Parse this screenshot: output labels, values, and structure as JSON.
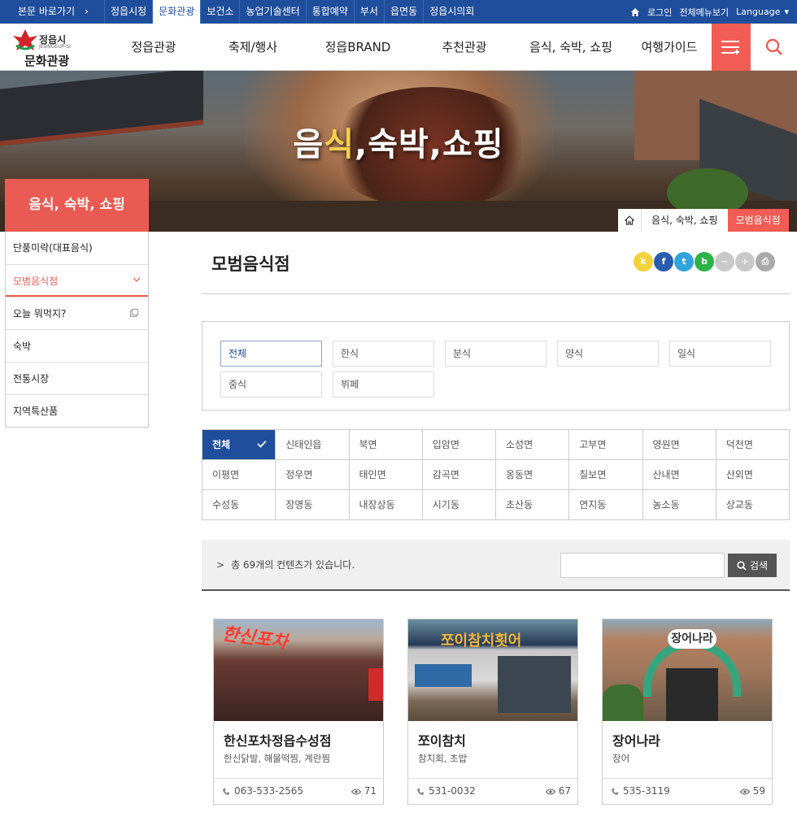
{
  "topbar": {
    "skip_label": "본문 바로가기",
    "skip_arrow": "›",
    "menu": [
      "정읍시청",
      "문화관광",
      "보건소",
      "농업기술센터",
      "통합예약",
      "부서",
      "읍면동",
      "정읍시의회"
    ],
    "active_index": 1,
    "login": "로그인",
    "sitemap": "전체메뉴보기",
    "language": "Language",
    "language_caret": "▾"
  },
  "nav": {
    "logo_city": "정읍시",
    "logo_en": "JEONGEUP-SI",
    "logo_title": "문화관광",
    "items": [
      "정읍관광",
      "축제/행사",
      "정읍BRAND",
      "추천관광",
      "음식, 숙박, 쇼핑",
      "여행가이드"
    ],
    "menu_icon": "hamburger-menu-icon",
    "search_icon": "search-icon"
  },
  "banner": {
    "headline_part1": "음",
    "headline_part2": "식",
    "headline_part3": ",숙박,쇼핑",
    "category": "음식, 숙박, 쇼핑",
    "breadcrumb": [
      "음식, 숙박, 쇼핑",
      "모범음식점"
    ]
  },
  "lnb": {
    "items": [
      "단풍미락(대표음식)",
      "모범음식점",
      "오늘 뭐먹지?",
      "숙박",
      "전통시장",
      "지역특산품"
    ],
    "active_index": 1
  },
  "content": {
    "title": "모범음식점",
    "share": [
      {
        "label": "k",
        "color": "#f3d33a",
        "name": "kakaostory-icon"
      },
      {
        "label": "f",
        "color": "#2a5db0",
        "name": "facebook-icon"
      },
      {
        "label": "t",
        "color": "#33a3dc",
        "name": "twitter-icon"
      },
      {
        "label": "b",
        "color": "#2db34a",
        "name": "blog-icon"
      },
      {
        "label": "−",
        "color": "#c9c9c9",
        "name": "zoom-out-icon"
      },
      {
        "label": "+",
        "color": "#c9c9c9",
        "name": "zoom-in-icon"
      },
      {
        "label": "⎙",
        "color": "#aaaaaa",
        "name": "print-icon"
      }
    ],
    "types": [
      "전체",
      "한식",
      "분식",
      "양식",
      "일식",
      "중식",
      "뷔페"
    ],
    "types_active": 0,
    "regions": [
      [
        "전체",
        "신태인읍",
        "북면",
        "입암면",
        "소성면",
        "고부면",
        "영원면",
        "덕천면"
      ],
      [
        "이평면",
        "정우면",
        "태인면",
        "감곡면",
        "옹동면",
        "칠보면",
        "산내면",
        "산외면"
      ],
      [
        "수성동",
        "장명동",
        "내장상동",
        "시기동",
        "초산동",
        "연지동",
        "농소동",
        "상교동"
      ]
    ],
    "count_arrow": ">",
    "count_text": "총 69개의 컨텐츠가 있습니다.",
    "search_placeholder": "",
    "search_button": "검색"
  },
  "cards": [
    {
      "name": "한신포차정읍수성점",
      "desc": "한신닭발, 해물떡찜, 계란찜",
      "tel": "063-533-2565",
      "views": "71",
      "sign": "한신포차"
    },
    {
      "name": "쪼이참치",
      "desc": "참치회, 초밥",
      "tel": "531-0032",
      "views": "67",
      "sign": "쪼이참치횟어"
    },
    {
      "name": "장어나라",
      "desc": "장어",
      "tel": "535-3119",
      "views": "59",
      "sign": "장어나라"
    }
  ],
  "colors": {
    "brand_blue": "#1f4e9c",
    "accent_red": "#f15d55"
  }
}
